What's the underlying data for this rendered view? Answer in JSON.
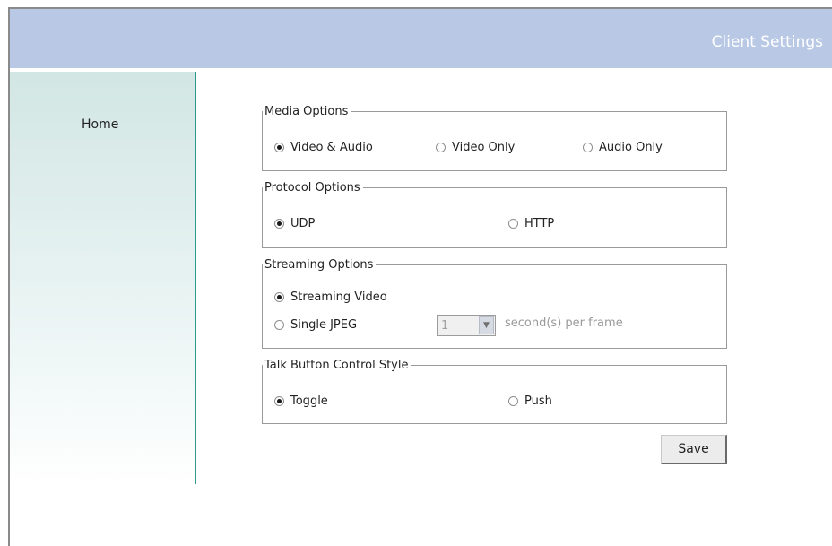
{
  "header": {
    "title": "Client Settings"
  },
  "sidebar": {
    "items": [
      {
        "label": "Home"
      }
    ]
  },
  "media_options": {
    "legend": "Media Options",
    "options": [
      {
        "label": "Video & Audio",
        "checked": true
      },
      {
        "label": "Video Only",
        "checked": false
      },
      {
        "label": "Audio Only",
        "checked": false
      }
    ]
  },
  "protocol_options": {
    "legend": "Protocol Options",
    "options": [
      {
        "label": "UDP",
        "checked": true
      },
      {
        "label": "HTTP",
        "checked": false
      }
    ]
  },
  "streaming_options": {
    "legend": "Streaming Options",
    "options": [
      {
        "label": "Streaming Video",
        "checked": true
      },
      {
        "label": "Single JPEG",
        "checked": false
      }
    ],
    "frame_interval": {
      "value": "1",
      "suffix": "second(s) per frame",
      "disabled": true
    }
  },
  "talk_button": {
    "legend": "Talk Button Control Style",
    "options": [
      {
        "label": "Toggle",
        "checked": true
      },
      {
        "label": "Push",
        "checked": false
      }
    ]
  },
  "actions": {
    "save_label": "Save"
  },
  "colors": {
    "header_bg": "#b9c9e5",
    "sidebar_accent": "#2f9a8c"
  }
}
